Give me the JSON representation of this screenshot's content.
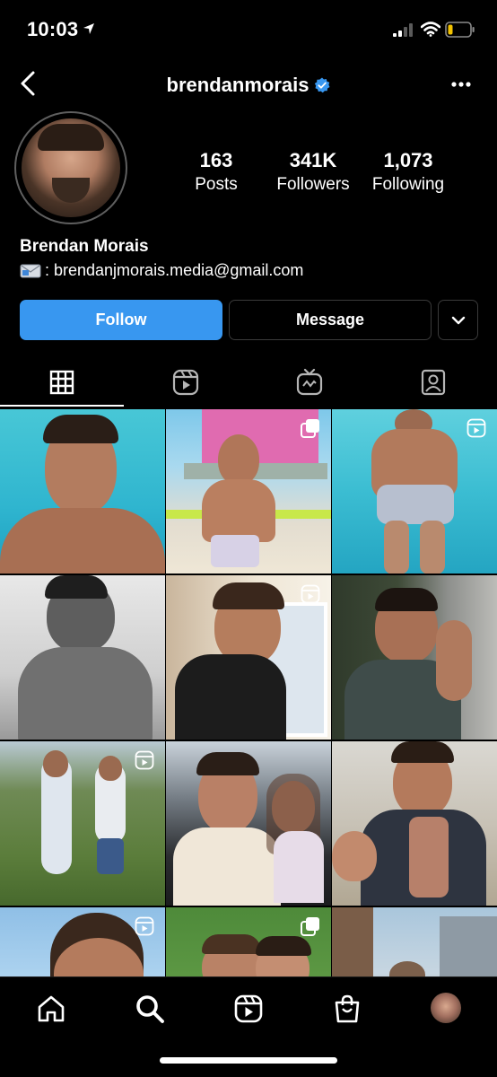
{
  "status_bar": {
    "time": "10:03",
    "icons": [
      "location-arrow-icon",
      "signal-icon",
      "wifi-icon",
      "battery-icon"
    ]
  },
  "header": {
    "username": "brendanmorais",
    "verified": true,
    "back_icon": "chevron-left-icon",
    "more_icon": "ellipsis-icon"
  },
  "profile": {
    "full_name": "Brendan Morais",
    "bio_icon": "envelope-emoji",
    "bio_text": ": brendanjmorais.media@gmail.com",
    "stats": {
      "posts": {
        "value": "163",
        "label": "Posts"
      },
      "followers": {
        "value": "341K",
        "label": "Followers"
      },
      "following": {
        "value": "1,073",
        "label": "Following"
      }
    }
  },
  "actions": {
    "follow": "Follow",
    "message": "Message",
    "more_icon": "chevron-down-icon"
  },
  "tabs": [
    {
      "name": "posts-grid",
      "icon": "grid-icon",
      "active": true
    },
    {
      "name": "reels",
      "icon": "reels-icon",
      "active": false
    },
    {
      "name": "igtv",
      "icon": "igtv-icon",
      "active": false
    },
    {
      "name": "tagged",
      "icon": "tagged-icon",
      "active": false
    }
  ],
  "grid": [
    {
      "type": "photo",
      "scene": "pool",
      "badge": ""
    },
    {
      "type": "carousel",
      "scene": "beach-lifeguard",
      "badge": "carousel-icon"
    },
    {
      "type": "reel",
      "scene": "pool-swim",
      "badge": "reels-icon"
    },
    {
      "type": "photo",
      "scene": "bw-portrait",
      "badge": ""
    },
    {
      "type": "reel",
      "scene": "indoor-window",
      "badge": "reels-icon"
    },
    {
      "type": "photo",
      "scene": "plants-portrait",
      "badge": ""
    },
    {
      "type": "reel",
      "scene": "garden-pair",
      "badge": "reels-icon"
    },
    {
      "type": "photo",
      "scene": "car-selfie",
      "badge": ""
    },
    {
      "type": "photo",
      "scene": "beach-plaid",
      "badge": ""
    },
    {
      "type": "reel",
      "scene": "closeup-sky",
      "badge": "reels-icon"
    },
    {
      "type": "carousel",
      "scene": "hedge-pair",
      "badge": "carousel-icon"
    },
    {
      "type": "photo",
      "scene": "patio",
      "badge": ""
    }
  ],
  "bottom_nav": [
    "home-icon",
    "search-icon",
    "reels-icon",
    "shop-icon",
    "profile-avatar"
  ],
  "colors": {
    "background": "#000000",
    "follow_button": "#3897f0",
    "verified": "#3897f0",
    "border": "#3a3a3a"
  }
}
